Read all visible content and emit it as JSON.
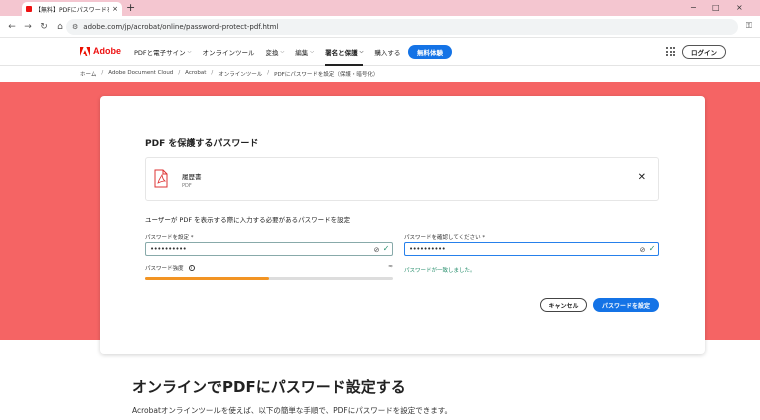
{
  "browser": {
    "tab_title": "【無料】PDFにパスワードを設定す",
    "tab_close": "×",
    "new_tab": "+",
    "window_controls": [
      "−",
      "□",
      "×"
    ],
    "url": "adobe.com/jp/acrobat/online/password-protect-pdf.html"
  },
  "nav": {
    "brand": "Adobe",
    "items": [
      {
        "label": "PDFと電子サイン",
        "dropdown": true
      },
      {
        "label": "オンラインツール",
        "dropdown": false
      },
      {
        "label": "変換",
        "dropdown": true
      },
      {
        "label": "編集",
        "dropdown": true
      },
      {
        "label": "署名と保護",
        "dropdown": true,
        "active": true
      },
      {
        "label": "購入する",
        "dropdown": false
      }
    ],
    "trial_button": "無料体験",
    "login_button": "ログイン"
  },
  "breadcrumb": [
    "ホーム",
    "Adobe Document Cloud",
    "Acrobat",
    "オンラインツール",
    "PDFにパスワードを設定（保護・暗号化）"
  ],
  "card": {
    "title": "PDF を保護するパスワード",
    "file": {
      "name": "履歴書",
      "type": "PDF"
    },
    "description": "ユーザーが PDF を表示する際に入力する必要があるパスワードを設定",
    "password": {
      "label": "パスワードを設定 *",
      "value": "••••••••••"
    },
    "confirm": {
      "label": "パスワードを確認してください *",
      "value": "••••••••••"
    },
    "strength": {
      "label": "パスワード強度",
      "level": 0.5
    },
    "match_message": "パスワードが一致しました。",
    "cancel_button": "キャンセル",
    "submit_button": "パスワードを設定"
  },
  "section": {
    "title": "オンラインでPDFにパスワード設定する",
    "text": "Acrobatオンラインツールを使えば、以下の簡単な手順で、PDFにパスワードを設定できます。"
  },
  "colors": {
    "hero_bg": "#f56464",
    "accent_blue": "#1473e6",
    "adobe_red": "#eb1000",
    "success_green": "#268e6c",
    "strength_orange": "#f29423"
  },
  "icons": {
    "file": "pdf-file-icon",
    "close": "close-icon",
    "eye": "eye-slash-icon",
    "check": "check-icon",
    "info": "info-icon",
    "apps": "app-grid-icon"
  }
}
